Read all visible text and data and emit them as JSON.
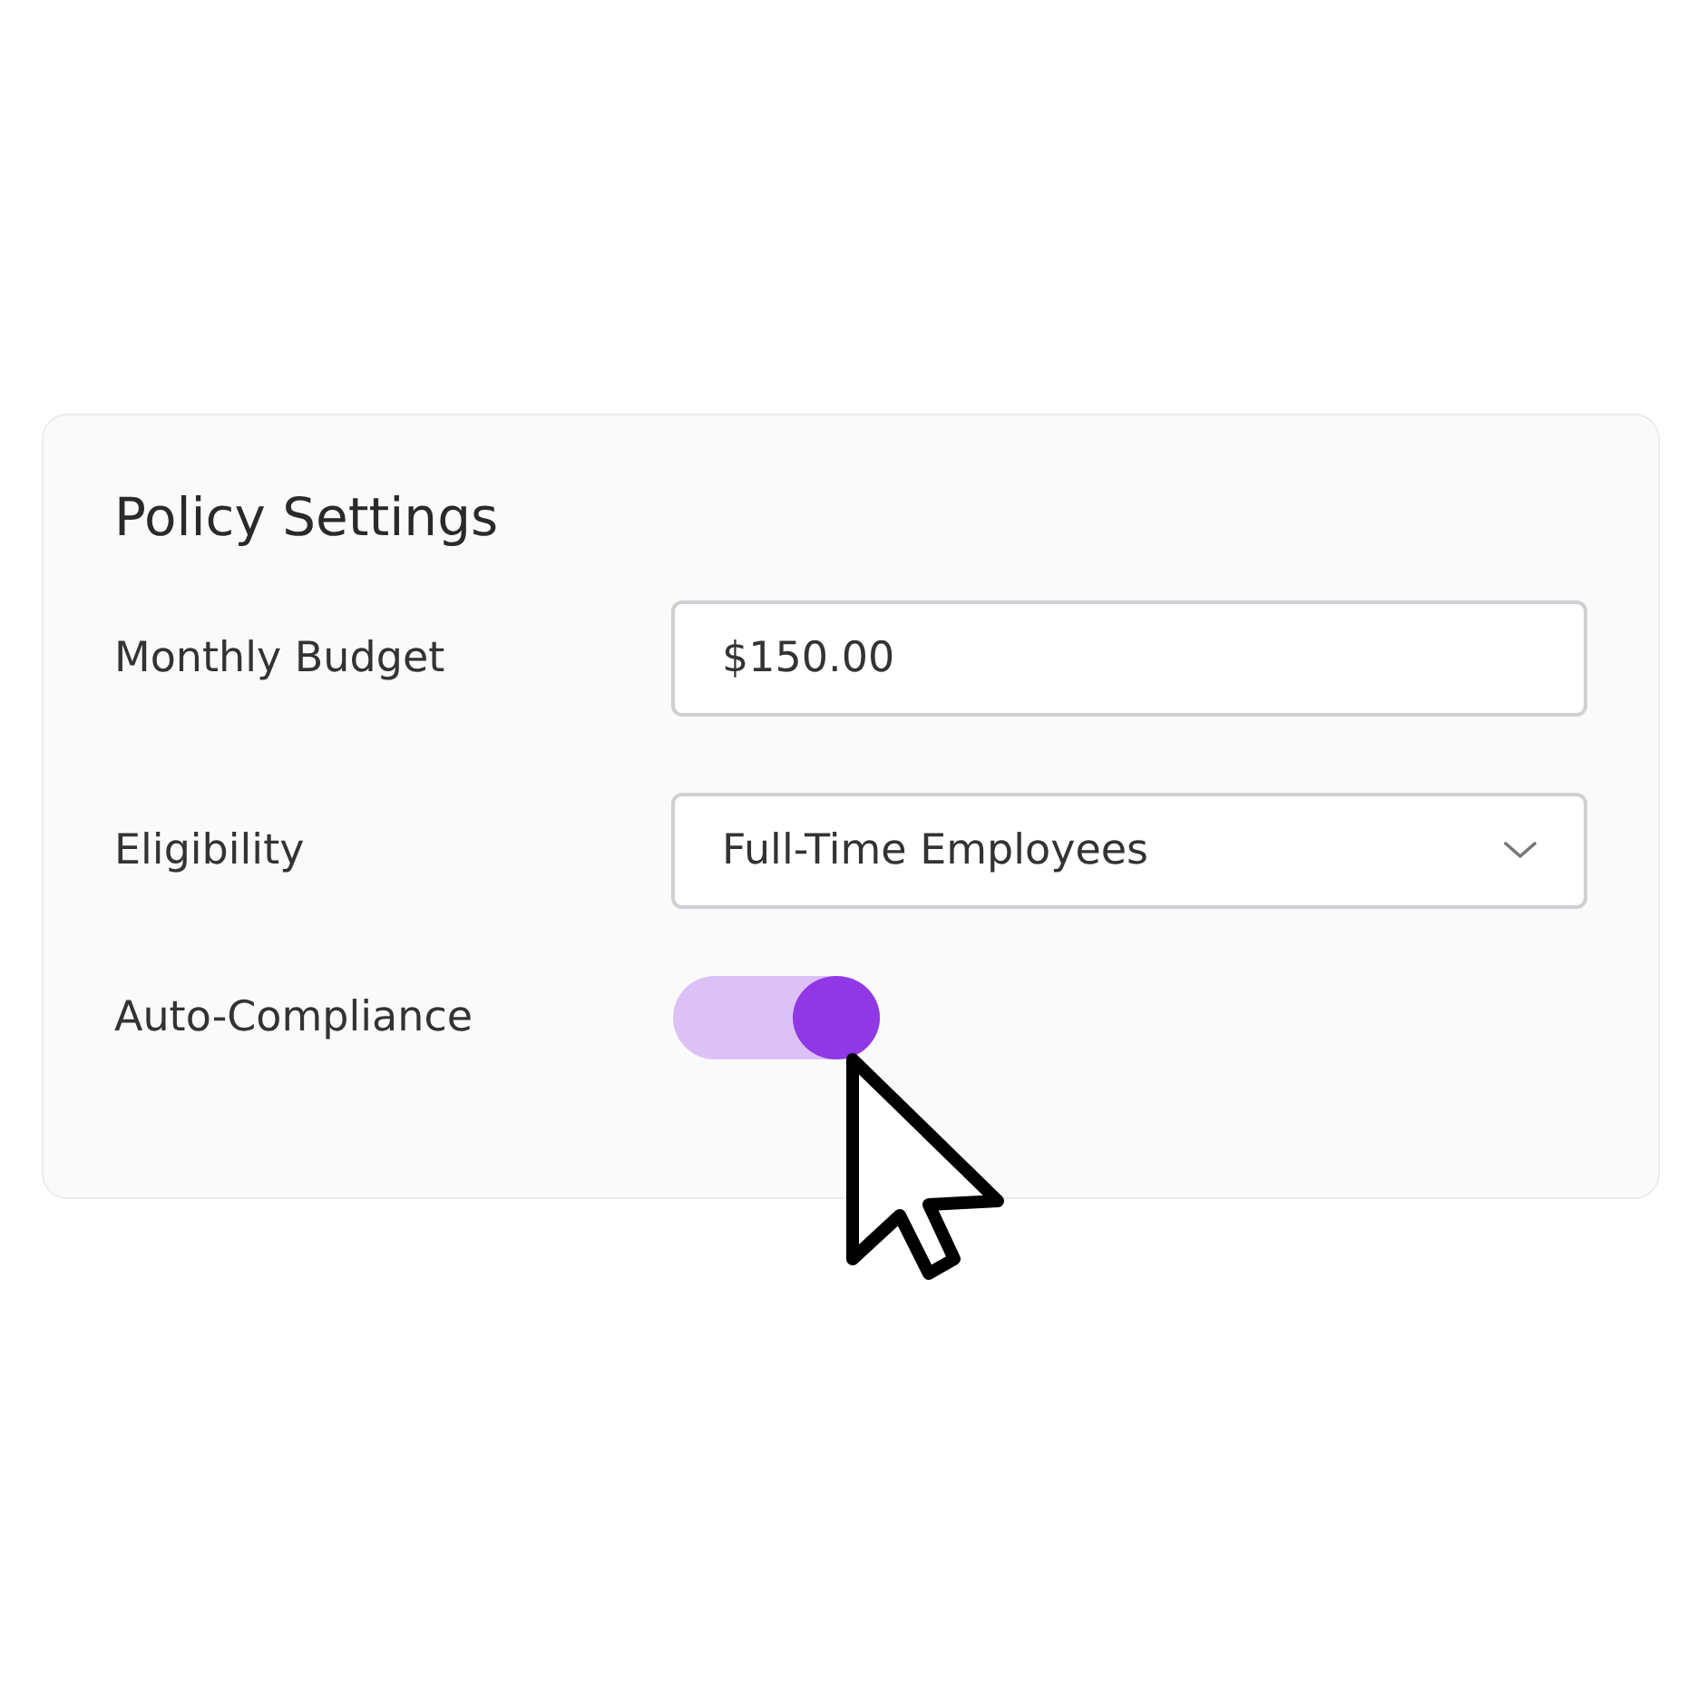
{
  "card": {
    "title": "Policy Settings",
    "fields": [
      {
        "kind": "text",
        "label": "Monthly Budget",
        "value": "$150.00"
      },
      {
        "kind": "select",
        "label": "Eligibility",
        "value": "Full-Time Employees"
      },
      {
        "kind": "toggle",
        "label": "Auto-Compliance",
        "on": true
      }
    ]
  }
}
